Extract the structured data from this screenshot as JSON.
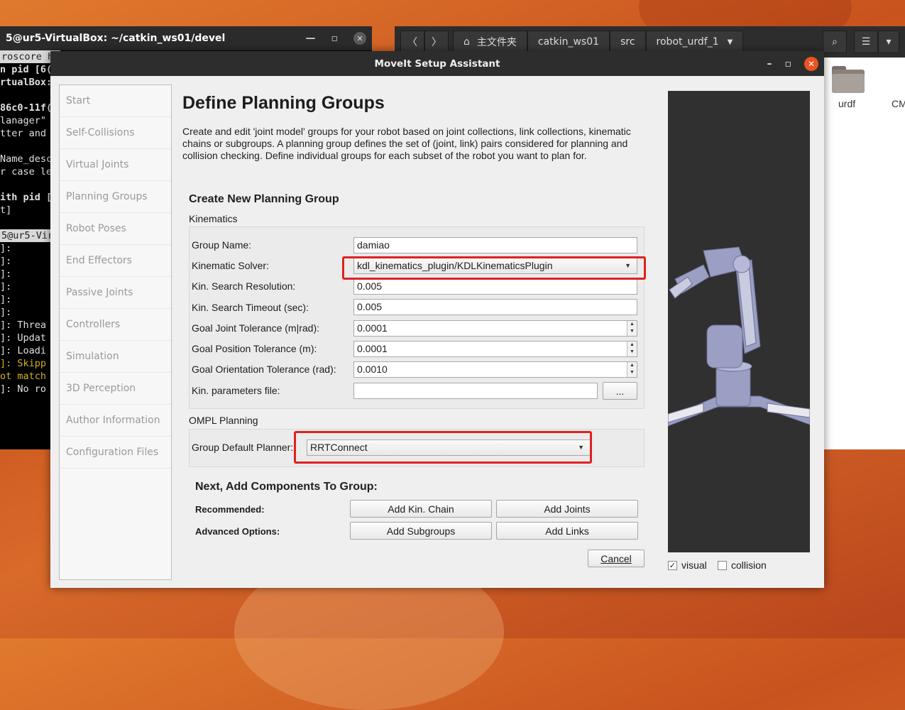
{
  "terminal": {
    "title": "5@ur5-VirtualBox: ~/catkin_ws01/devel",
    "tab_label": "roscore ht",
    "lines": [
      {
        "text": "n pid [6(",
        "style": "bold"
      },
      {
        "text": "rtualBox:",
        "style": "bold"
      },
      {
        "text": "",
        "style": ""
      },
      {
        "text": "86c0-11f(",
        "style": "bold"
      },
      {
        "text": "lanager\"",
        "style": ""
      },
      {
        "text": "tter and",
        "style": ""
      },
      {
        "text": "",
        "style": ""
      },
      {
        "text": "Name_desc",
        "style": ""
      },
      {
        "text": "r case le",
        "style": ""
      },
      {
        "text": "",
        "style": ""
      },
      {
        "text": "ith pid [",
        "style": "bold"
      },
      {
        "text": "t]",
        "style": ""
      },
      {
        "text": "",
        "style": ""
      },
      {
        "text": "5@ur5-Virt",
        "style": "hl"
      },
      {
        "text": "]:",
        "style": ""
      },
      {
        "text": "]:",
        "style": ""
      },
      {
        "text": "]:",
        "style": ""
      },
      {
        "text": "]:",
        "style": ""
      },
      {
        "text": "]:",
        "style": ""
      },
      {
        "text": "]:",
        "style": ""
      },
      {
        "text": "]: Threa",
        "style": ""
      },
      {
        "text": "]: Updat",
        "style": ""
      },
      {
        "text": "]: Loadi",
        "style": ""
      },
      {
        "text": "]: Skipp",
        "style": "yel"
      },
      {
        "text": "ot match",
        "style": "yel"
      },
      {
        "text": "]: No ro",
        "style": ""
      }
    ]
  },
  "files": {
    "crumbs": [
      "主文件夹",
      "catkin_ws01",
      "src",
      "robot_urdf_1"
    ],
    "folder_label": "urdf",
    "partial_label": "CM"
  },
  "dialog": {
    "title": "MoveIt Setup Assistant",
    "nav": [
      "Start",
      "Self-Collisions",
      "Virtual Joints",
      "Planning Groups",
      "Robot Poses",
      "End Effectors",
      "Passive Joints",
      "Controllers",
      "Simulation",
      "3D Perception",
      "Author Information",
      "Configuration Files"
    ],
    "heading": "Define Planning Groups",
    "description": "Create and edit 'joint model' groups for your robot based on joint collections, link collections, kinematic chains or subgroups. A planning group defines the set of (joint, link) pairs considered for planning and collision checking. Define individual groups for each subset of the robot you want to plan for.",
    "create_heading": "Create New Planning Group",
    "kinematics_label": "Kinematics",
    "form": {
      "group_name_label": "Group Name:",
      "group_name_value": "damiao",
      "solver_label": "Kinematic Solver:",
      "solver_value": "kdl_kinematics_plugin/KDLKinematicsPlugin",
      "resolution_label": "Kin. Search Resolution:",
      "resolution_value": "0.005",
      "timeout_label": "Kin. Search Timeout (sec):",
      "timeout_value": "0.005",
      "joint_tol_label": "Goal Joint Tolerance (m|rad):",
      "joint_tol_value": "0.0001",
      "pos_tol_label": "Goal Position Tolerance (m):",
      "pos_tol_value": "0.0001",
      "orient_tol_label": "Goal Orientation Tolerance (rad):",
      "orient_tol_value": "0.0010",
      "params_label": "Kin. parameters file:",
      "params_value": "",
      "browse_label": "..."
    },
    "ompl_label": "OMPL Planning",
    "planner_label": "Group Default Planner:",
    "planner_value": "RRTConnect",
    "next_heading": "Next, Add Components To Group:",
    "recommended_label": "Recommended:",
    "advanced_label": "Advanced Options:",
    "buttons": {
      "kin_chain": "Add Kin. Chain",
      "joints": "Add Joints",
      "subgroups": "Add Subgroups",
      "links": "Add Links",
      "cancel": "Cancel"
    },
    "viewer": {
      "visual_label": "visual",
      "visual_checked": true,
      "collision_label": "collision",
      "collision_checked": false
    }
  },
  "colors": {
    "highlight_box": "#e02020",
    "title_bar": "#2d2d2d",
    "close_button": "#e95420"
  }
}
